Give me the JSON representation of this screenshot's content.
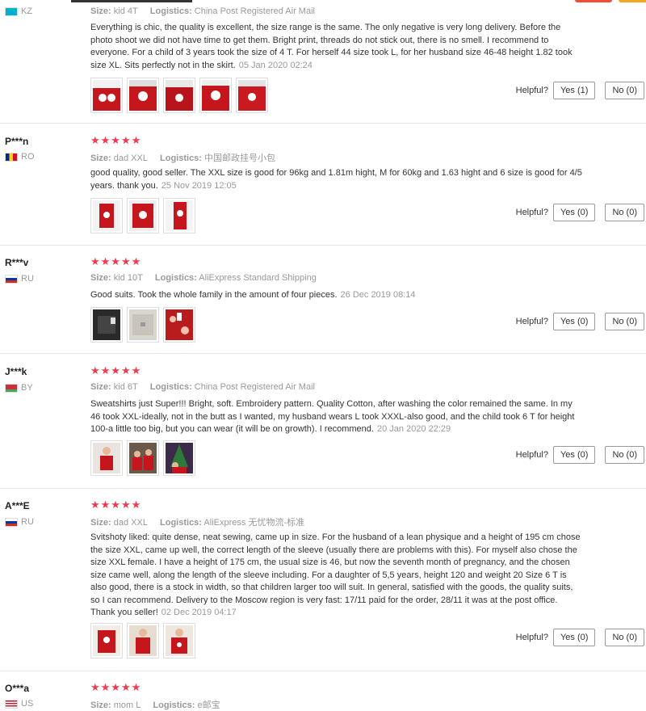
{
  "colors": {
    "star": "#f5394c",
    "button_border": "#999999",
    "meta": "#999999",
    "top_orange": "#f5a623",
    "top_red": "#f04e37"
  },
  "helpful_label": "Helpful?",
  "reviews": [
    {
      "user": "",
      "country": "KZ",
      "size_label": "Size:",
      "size": "kid 4T",
      "logistics_label": "Logistics:",
      "logistics": "China Post Registered Air Mail",
      "text": "Everything is chic, the quality is excellent, the size range is the same. The only negative is very long delivery. Before the photo shoot we did not have time to get them. Bright print, threads do not stick out, there is no smell. I recommend to everyone. For a child of 3 years took the size of 4 T. For herself 44 size took L, for her husband size 46-48 height 1.82 took size XL. Sits perfectly not in the skirt.",
      "date": "05 Jan 2020 02:24",
      "yes": "Yes (1)",
      "no": "No (0)",
      "photos": [
        "red-sweater-photo",
        "red-sweater-photo",
        "red-sweater-photo",
        "red-sweater-photo",
        "red-sweater-photo"
      ]
    },
    {
      "user": "P***n",
      "country": "RO",
      "size_label": "Size:",
      "size": "dad XXL",
      "logistics_label": "Logistics:",
      "logistics": "中国邮政挂号小包",
      "text": "good quality, good seller. The XXL size is good for 96kg and 1.81m hight, M for 60kg and 1.63 hight and 6 size is good for 4/5 years. thank you.",
      "date": "25 Nov 2019 12:05",
      "yes": "Yes (0)",
      "no": "No (0)",
      "photos": [
        "red-sweater-photo",
        "red-sweater-photo",
        "red-sweater-photo"
      ]
    },
    {
      "user": "R***v",
      "country": "RU",
      "size_label": "Size:",
      "size": "kid 10T",
      "logistics_label": "Logistics:",
      "logistics": "AliExpress Standard Shipping",
      "text": "Good suits. Took the whole family in the amount of four pieces.",
      "date": "26 Dec 2019 08:14",
      "yes": "Yes (0)",
      "no": "No (0)",
      "photos": [
        "dark-package-photo",
        "gray-package-photo",
        "red-sweaters-photo"
      ]
    },
    {
      "user": "J***k",
      "country": "BY",
      "size_label": "Size:",
      "size": "kid 6T",
      "logistics_label": "Logistics:",
      "logistics": "China Post Registered Air Mail",
      "text": "Sweatshirts just Super!!! Bright, soft. Embroidery pattern. Quality Cotton, after washing the color remained the same. In my 46 took XXL-ideally, not in the butt as I wanted, my husband wears L took XXXL-also good, and the child took 6 T for height 100-a little too big, but you can wear (it will be on growth). I recommend.",
      "date": "20 Jan 2020 22:29",
      "yes": "Yes (0)",
      "no": "No (0)",
      "photos": [
        "child-photo",
        "family-photo",
        "christmas-tree-photo"
      ]
    },
    {
      "user": "A***E",
      "country": "RU",
      "size_label": "Size:",
      "size": "dad XXL",
      "logistics_label": "Logistics:",
      "logistics": "AliExpress 无忧物流-标准",
      "text": "Svitshoty liked: quite dense, neat sewing, came up in size. For the husband of a lean physique and a height of 195 cm chose the size XXL, came up well, the correct length of the sleeve (usually there are problems with this). For myself also chose the size XXL female. I have a height of 175 cm, the usual size is 46, but now the seventh month of pregnancy, and the chosen size came well, along the length of the sleeve including. For a daughter of 5,5 years, height 120 and weight 20 Size 6 T is also good, there is a stock in width, so that children larger too will suit. In general, satisfied with the goods, the quality suits, so I can recommend. Delivery to the Moscow region is very fast: 17/11 paid for the order, 28/11 it was at the post office. Thank you seller!",
      "date": "02 Dec 2019 04:17",
      "yes": "Yes (0)",
      "no": "No (0)",
      "photos": [
        "red-sweater-photo",
        "red-sweater-photo",
        "red-sweater-photo"
      ]
    },
    {
      "user": "O***a",
      "country": "US",
      "size_label": "Size:",
      "size": "mom L",
      "logistics_label": "Logistics:",
      "logistics": "e邮宝",
      "text": "",
      "date": "",
      "yes": "",
      "no": "",
      "photos": []
    }
  ]
}
